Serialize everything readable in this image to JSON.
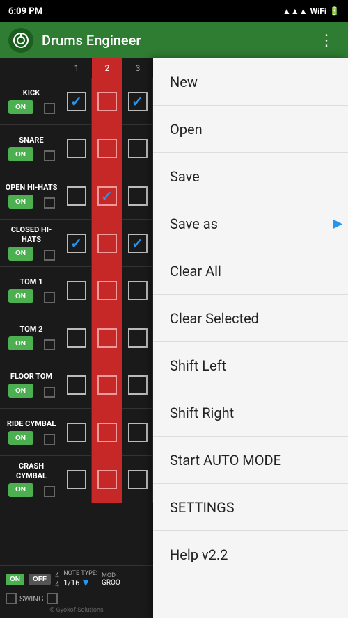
{
  "status_bar": {
    "time": "6:09 PM",
    "signal": "▲▲▲",
    "wifi": "WiFi",
    "battery": "100"
  },
  "title_bar": {
    "title": "Drums Engineer",
    "icon": "🥁",
    "menu_icon": "⋮"
  },
  "grid": {
    "col_headers": [
      "1",
      "2",
      "3"
    ],
    "col2_is_red": true,
    "rows": [
      {
        "name": "KICK",
        "btn": "ON",
        "cells": [
          {
            "checked": true,
            "red": false
          },
          {
            "checked": false,
            "red": true
          },
          {
            "checked": true,
            "red": false
          }
        ]
      },
      {
        "name": "SNARE",
        "btn": "ON",
        "cells": [
          {
            "checked": false,
            "red": false
          },
          {
            "checked": false,
            "red": true
          },
          {
            "checked": false,
            "red": false
          }
        ]
      },
      {
        "name": "OPEN HI-HATS",
        "btn": "ON",
        "cells": [
          {
            "checked": false,
            "red": false
          },
          {
            "checked": true,
            "red": true
          },
          {
            "checked": false,
            "red": false
          }
        ]
      },
      {
        "name": "CLOSED HI-HATS",
        "btn": "ON",
        "cells": [
          {
            "checked": true,
            "red": false
          },
          {
            "checked": false,
            "red": true
          },
          {
            "checked": true,
            "red": false
          }
        ]
      },
      {
        "name": "TOM 1",
        "btn": "ON",
        "cells": [
          {
            "checked": false,
            "red": false
          },
          {
            "checked": false,
            "red": true
          },
          {
            "checked": false,
            "red": false
          }
        ]
      },
      {
        "name": "TOM 2",
        "btn": "ON",
        "cells": [
          {
            "checked": false,
            "red": false
          },
          {
            "checked": false,
            "red": true
          },
          {
            "checked": false,
            "red": false
          }
        ]
      },
      {
        "name": "FLOOR TOM",
        "btn": "ON",
        "cells": [
          {
            "checked": false,
            "red": false
          },
          {
            "checked": false,
            "red": true
          },
          {
            "checked": false,
            "red": false
          }
        ]
      },
      {
        "name": "RIDE CYMBAL",
        "btn": "ON",
        "cells": [
          {
            "checked": false,
            "red": false
          },
          {
            "checked": false,
            "red": true
          },
          {
            "checked": false,
            "red": false
          }
        ]
      },
      {
        "name": "CRASH CYMBAL",
        "btn": "ON",
        "cells": [
          {
            "checked": false,
            "red": false
          },
          {
            "checked": false,
            "red": true
          },
          {
            "checked": false,
            "red": false
          }
        ]
      }
    ]
  },
  "bottom": {
    "on_label": "ON",
    "off_label": "OFF",
    "time_sig_top": "4",
    "time_sig_bottom": "4",
    "note_type_label": "NOTE TYPE:",
    "note_value": "1/16",
    "mode_label": "MOD",
    "mode_value": "GROO",
    "swing_label": "SWING",
    "copyright": "© Gyokof Solutions"
  },
  "menu": {
    "items": [
      {
        "label": "New",
        "has_arrow": false
      },
      {
        "label": "Open",
        "has_arrow": false
      },
      {
        "label": "Save",
        "has_arrow": false
      },
      {
        "label": "Save as",
        "has_arrow": true
      },
      {
        "label": "Clear All",
        "has_arrow": false
      },
      {
        "label": "Clear Selected",
        "has_arrow": false
      },
      {
        "label": "Shift Left",
        "has_arrow": false
      },
      {
        "label": "Shift Right",
        "has_arrow": false
      },
      {
        "label": "Start AUTO MODE",
        "has_arrow": false
      },
      {
        "label": "SETTINGS",
        "has_arrow": false
      },
      {
        "label": "Help v2.2",
        "has_arrow": false
      }
    ]
  }
}
